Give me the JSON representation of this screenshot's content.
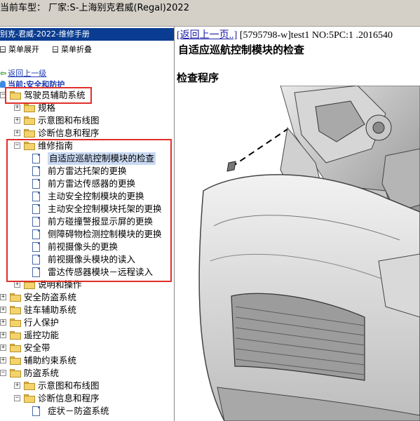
{
  "header": {
    "caption": "当前车型： 厂家:S-上海别克君威(Regal)2022"
  },
  "tree_pane": {
    "title": "别克-君威-2022-维修手册",
    "expand_label": "菜单展开",
    "collapse_label": "菜单折叠",
    "back_label": "返回上一级",
    "current_label": "当前:安全和防护",
    "items": [
      {
        "label": "驾驶员辅助系统",
        "expander": "−",
        "kind": "folder"
      },
      {
        "label": "规格",
        "expander": "+",
        "kind": "folder"
      },
      {
        "label": "示意图和布线图",
        "expander": "+",
        "kind": "folder"
      },
      {
        "label": "诊断信息和程序",
        "expander": "+",
        "kind": "folder"
      },
      {
        "label": "维修指南",
        "expander": "−",
        "kind": "folder"
      },
      {
        "label": "自适应巡航控制模块的检查",
        "kind": "doc",
        "selected": true
      },
      {
        "label": "前方雷达托架的更换",
        "kind": "doc"
      },
      {
        "label": "前方雷达传感器的更换",
        "kind": "doc"
      },
      {
        "label": "主动安全控制模块的更换",
        "kind": "doc"
      },
      {
        "label": "主动安全控制模块托架的更换",
        "kind": "doc"
      },
      {
        "label": "前方碰撞警报显示屏的更换",
        "kind": "doc"
      },
      {
        "label": "侧障碍物检测控制模块的更换",
        "kind": "doc"
      },
      {
        "label": "前视摄像头的更换",
        "kind": "doc"
      },
      {
        "label": "前视摄像头模块的读入",
        "kind": "doc"
      },
      {
        "label": "雷达传感器模块－远程读入",
        "kind": "doc"
      },
      {
        "label": "说明和操作",
        "expander": "+",
        "kind": "folder"
      },
      {
        "label": "安全防盗系统",
        "expander": "+",
        "kind": "folder"
      },
      {
        "label": "驻车辅助系统",
        "expander": "+",
        "kind": "folder"
      },
      {
        "label": "行人保护",
        "expander": "+",
        "kind": "folder"
      },
      {
        "label": "遥控功能",
        "expander": "+",
        "kind": "folder"
      },
      {
        "label": "安全带",
        "expander": "+",
        "kind": "folder"
      },
      {
        "label": "辅助约束系统",
        "expander": "+",
        "kind": "folder"
      },
      {
        "label": "防盗系统",
        "expander": "−",
        "kind": "folder"
      },
      {
        "label": "示意图和布线图",
        "expander": "+",
        "kind": "folder"
      },
      {
        "label": "诊断信息和程序",
        "expander": "−",
        "kind": "folder"
      },
      {
        "label": "症状－防盗系统",
        "kind": "doc"
      }
    ]
  },
  "content": {
    "back_link": "[返回上一页..]",
    "doc_info": " [5795798-w]test1 NO:5PC:1 .2016540",
    "title": "自适应巡航控制模块的检查",
    "subtitle": "检查程序"
  },
  "colors": {
    "highlight_box": "#e0302a",
    "tree_title_bg": "#0a3d91",
    "link": "#1e3cb4",
    "selected_bg": "#c9d9f2"
  }
}
